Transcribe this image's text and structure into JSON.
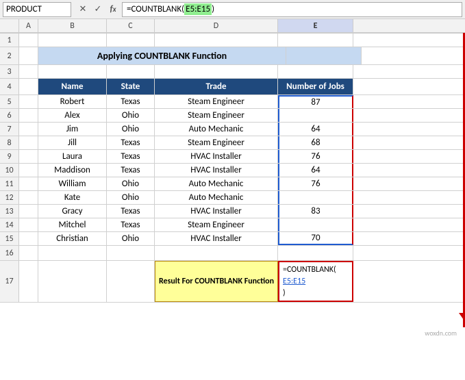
{
  "namebox": "PRODUCT",
  "formula": "=COUNTBLANK(E5:E15)",
  "formula_parts": {
    "prefix": "=COUNTBLANK(",
    "highlight": "E5:E15",
    "suffix": ")"
  },
  "columns": [
    "A",
    "B",
    "C",
    "D",
    "E"
  ],
  "col_headers": [
    "A",
    "B",
    "C",
    "D",
    "E"
  ],
  "title": "Applying COUNTBLANK Function",
  "table_headers": [
    "Name",
    "State",
    "Trade",
    "Number of Jobs"
  ],
  "rows": [
    {
      "num": 1,
      "b": "",
      "c": "",
      "d": "",
      "e": ""
    },
    {
      "num": 2,
      "b": "",
      "c": "",
      "d": "Applying COUNTBLANK Function",
      "e": ""
    },
    {
      "num": 3,
      "b": "",
      "c": "",
      "d": "",
      "e": ""
    },
    {
      "num": 4,
      "b": "Name",
      "c": "State",
      "d": "Trade",
      "e": "Number of Jobs",
      "header": true
    },
    {
      "num": 5,
      "b": "Robert",
      "c": "Texas",
      "d": "Steam Engineer",
      "e": "87"
    },
    {
      "num": 6,
      "b": "Alex",
      "c": "Ohio",
      "d": "Steam Engineer",
      "e": ""
    },
    {
      "num": 7,
      "b": "Jim",
      "c": "Ohio",
      "d": "Auto Mechanic",
      "e": "64"
    },
    {
      "num": 8,
      "b": "Jill",
      "c": "Texas",
      "d": "Steam Engineer",
      "e": "68"
    },
    {
      "num": 9,
      "b": "Laura",
      "c": "Texas",
      "d": "HVAC Installer",
      "e": "76"
    },
    {
      "num": 10,
      "b": "Maddison",
      "c": "Texas",
      "d": "HVAC Installer",
      "e": "64"
    },
    {
      "num": 11,
      "b": "William",
      "c": "Ohio",
      "d": "Auto Mechanic",
      "e": "76"
    },
    {
      "num": 12,
      "b": "Kate",
      "c": "Ohio",
      "d": "Auto Mechanic",
      "e": ""
    },
    {
      "num": 13,
      "b": "Gracy",
      "c": "Texas",
      "d": "HVAC Installer",
      "e": "83"
    },
    {
      "num": 14,
      "b": "Mitchel",
      "c": "Texas",
      "d": "Steam Engineer",
      "e": ""
    },
    {
      "num": 15,
      "b": "Christian",
      "c": "Ohio",
      "d": "HVAC Installer",
      "e": "70"
    },
    {
      "num": 16,
      "b": "",
      "c": "",
      "d": "",
      "e": ""
    },
    {
      "num": 17,
      "b": "",
      "c": "",
      "d": "Result For COUNTBLANK Function",
      "e": "=COUNTBLANK(\nE5:E15)",
      "result": true
    }
  ],
  "result_label": "Result For COUNTBLANK Function",
  "result_formula_line1": "=COUNTBLANK(",
  "result_formula_highlight": "E5:E15",
  "result_formula_suffix": ")",
  "watermark": "woxdn.com"
}
